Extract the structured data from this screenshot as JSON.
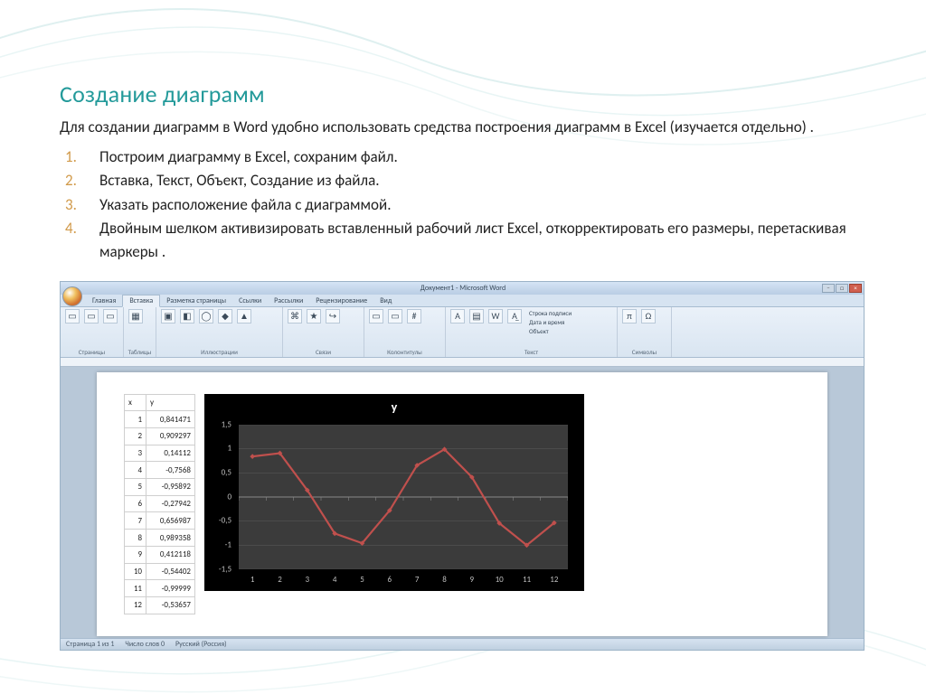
{
  "slide": {
    "title": "Создание диаграмм",
    "intro": "Для создании диаграмм в Word  удобно использовать средства построения диаграмм в Excel (изучается отдельно) .",
    "steps": [
      "Построим диаграмму в Excel, сохраним файл.",
      "Вставка, Текст, Объект, Создание из файла.",
      "Указать расположение файла с диаграммой.",
      "Двойным шелком активизировать вставленный рабочий лист Excel, откорректировать его размеры, перетаскивая маркеры ."
    ]
  },
  "word": {
    "title_center": "Документ1 - Microsoft Word",
    "tabs": [
      "Главная",
      "Вставка",
      "Разметка страницы",
      "Ссылки",
      "Рассылки",
      "Рецензирование",
      "Вид"
    ],
    "active_tab": "Вставка",
    "groups": [
      "Страницы",
      "Таблицы",
      "Иллюстрации",
      "Связи",
      "Колонтитулы",
      "Текст",
      "Символы"
    ],
    "quick": [
      "Строка подписи",
      "Дата и время",
      "Объект"
    ],
    "status": {
      "page": "Страница 1 из 1",
      "words": "Число слов 0",
      "lang": "Русский (Россия)"
    }
  },
  "table": {
    "headers": [
      "x",
      "y"
    ],
    "rows": [
      [
        1,
        "0,841471"
      ],
      [
        2,
        "0,909297"
      ],
      [
        3,
        "0,14112"
      ],
      [
        4,
        "-0,7568"
      ],
      [
        5,
        "-0,95892"
      ],
      [
        6,
        "-0,27942"
      ],
      [
        7,
        "0,656987"
      ],
      [
        8,
        "0,989358"
      ],
      [
        9,
        "0,412118"
      ],
      [
        10,
        "-0,54402"
      ],
      [
        11,
        "-0,99999"
      ],
      [
        12,
        "-0,53657"
      ]
    ]
  },
  "chart_data": {
    "type": "line",
    "title": "y",
    "xlabel": "",
    "ylabel": "",
    "x": [
      1,
      2,
      3,
      4,
      5,
      6,
      7,
      8,
      9,
      10,
      11,
      12
    ],
    "series": [
      {
        "name": "y",
        "values": [
          0.841471,
          0.909297,
          0.14112,
          -0.7568,
          -0.95892,
          -0.27942,
          0.656987,
          0.989358,
          0.412118,
          -0.54402,
          -0.99999,
          -0.53657
        ],
        "color": "#c0504d"
      }
    ],
    "ylim": [
      -1.5,
      1.5
    ],
    "yticks": [
      -1.5,
      -1,
      -0.5,
      0,
      0.5,
      1,
      1.5
    ],
    "xticks": [
      1,
      2,
      3,
      4,
      5,
      6,
      7,
      8,
      9,
      10,
      11,
      12
    ]
  }
}
